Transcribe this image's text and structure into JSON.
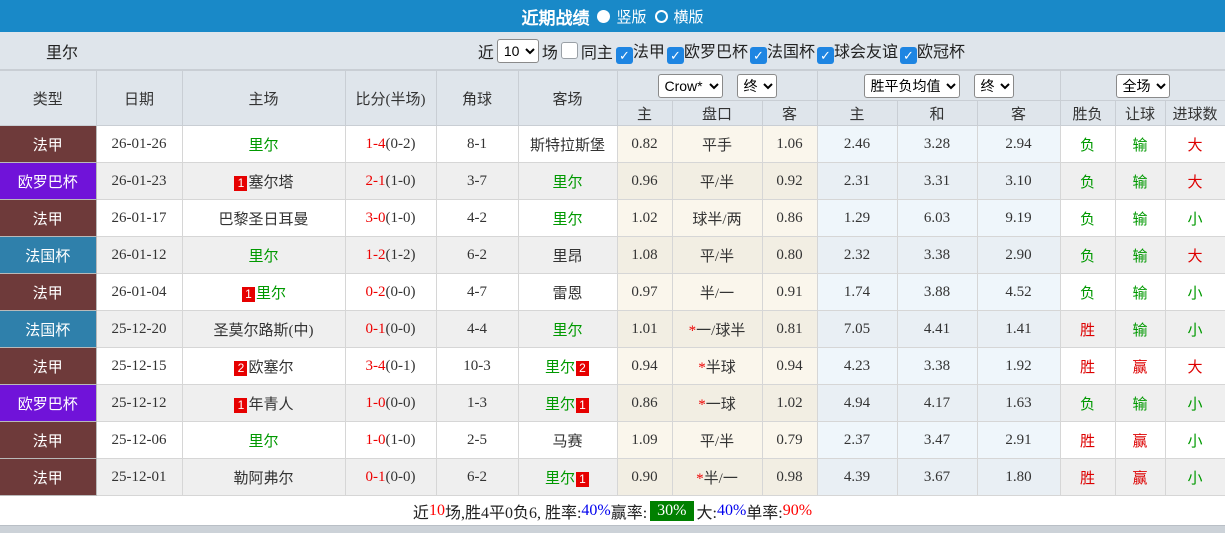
{
  "topbar": {
    "title": "近期战绩",
    "radio_vertical": "竖版",
    "radio_horizontal": "横版"
  },
  "filterbar": {
    "team": "里尔",
    "near_label": "近",
    "near_value": "10",
    "games_label": "场",
    "same_home_label": "同主",
    "leagues": [
      "法甲",
      "欧罗巴杯",
      "法国杯",
      "球会友谊",
      "欧冠杯"
    ]
  },
  "table": {
    "headers": {
      "type": "类型",
      "date": "日期",
      "home": "主场",
      "score": "比分(半场)",
      "corner": "角球",
      "away": "客场",
      "crow_select": "Crow*",
      "final1": "终",
      "avg_select": "胜平负均值",
      "final2": "终",
      "full_select": "全场",
      "sub": [
        "主",
        "盘口",
        "客",
        "主",
        "和",
        "客",
        "胜负",
        "让球",
        "进球数"
      ]
    },
    "league_colors": {
      "法甲": "#6e3a3a",
      "欧罗巴杯": "#7013d9",
      "法国杯": "#2f80ab"
    },
    "rows": [
      {
        "league": "法甲",
        "date": "26-01-26",
        "home": {
          "name": "里尔",
          "green": true,
          "badge": null
        },
        "score": "1-4",
        "half": "(0-2)",
        "corner": "8-1",
        "away": {
          "name": "斯特拉斯堡",
          "green": false,
          "badge": null
        },
        "crow": {
          "home": "0.82",
          "star": false,
          "handicap": "平手",
          "away": "1.06"
        },
        "avg": {
          "home": "2.46",
          "draw": "3.28",
          "away": "2.94"
        },
        "result": {
          "wdl": "负",
          "wdl_c": "green",
          "let": "输",
          "let_c": "green",
          "goals": "大",
          "goals_c": "red"
        }
      },
      {
        "league": "欧罗巴杯",
        "date": "26-01-23",
        "home": {
          "name": "塞尔塔",
          "green": false,
          "badge": "1"
        },
        "score": "2-1",
        "half": "(1-0)",
        "corner": "3-7",
        "away": {
          "name": "里尔",
          "green": true,
          "badge": null
        },
        "crow": {
          "home": "0.96",
          "star": false,
          "handicap": "平/半",
          "away": "0.92"
        },
        "avg": {
          "home": "2.31",
          "draw": "3.31",
          "away": "3.10"
        },
        "result": {
          "wdl": "负",
          "wdl_c": "green",
          "let": "输",
          "let_c": "green",
          "goals": "大",
          "goals_c": "red"
        }
      },
      {
        "league": "法甲",
        "date": "26-01-17",
        "home": {
          "name": "巴黎圣日耳曼",
          "green": false,
          "badge": null
        },
        "score": "3-0",
        "half": "(1-0)",
        "corner": "4-2",
        "away": {
          "name": "里尔",
          "green": true,
          "badge": null
        },
        "crow": {
          "home": "1.02",
          "star": false,
          "handicap": "球半/两",
          "away": "0.86"
        },
        "avg": {
          "home": "1.29",
          "draw": "6.03",
          "away": "9.19"
        },
        "result": {
          "wdl": "负",
          "wdl_c": "green",
          "let": "输",
          "let_c": "green",
          "goals": "小",
          "goals_c": "green"
        }
      },
      {
        "league": "法国杯",
        "date": "26-01-12",
        "home": {
          "name": "里尔",
          "green": true,
          "badge": null
        },
        "score": "1-2",
        "half": "(1-2)",
        "corner": "6-2",
        "away": {
          "name": "里昂",
          "green": false,
          "badge": null
        },
        "crow": {
          "home": "1.08",
          "star": false,
          "handicap": "平/半",
          "away": "0.80"
        },
        "avg": {
          "home": "2.32",
          "draw": "3.38",
          "away": "2.90"
        },
        "result": {
          "wdl": "负",
          "wdl_c": "green",
          "let": "输",
          "let_c": "green",
          "goals": "大",
          "goals_c": "red"
        }
      },
      {
        "league": "法甲",
        "date": "26-01-04",
        "home": {
          "name": "里尔",
          "green": true,
          "badge": "1"
        },
        "score": "0-2",
        "half": "(0-0)",
        "corner": "4-7",
        "away": {
          "name": "雷恩",
          "green": false,
          "badge": null
        },
        "crow": {
          "home": "0.97",
          "star": false,
          "handicap": "半/一",
          "away": "0.91"
        },
        "avg": {
          "home": "1.74",
          "draw": "3.88",
          "away": "4.52"
        },
        "result": {
          "wdl": "负",
          "wdl_c": "green",
          "let": "输",
          "let_c": "green",
          "goals": "小",
          "goals_c": "green"
        }
      },
      {
        "league": "法国杯",
        "date": "25-12-20",
        "home": {
          "name": "圣莫尔路斯(中)",
          "green": false,
          "badge": null
        },
        "score": "0-1",
        "half": "(0-0)",
        "corner": "4-4",
        "away": {
          "name": "里尔",
          "green": true,
          "badge": null
        },
        "crow": {
          "home": "1.01",
          "star": true,
          "handicap": "一/球半",
          "away": "0.81"
        },
        "avg": {
          "home": "7.05",
          "draw": "4.41",
          "away": "1.41"
        },
        "result": {
          "wdl": "胜",
          "wdl_c": "red",
          "let": "输",
          "let_c": "green",
          "goals": "小",
          "goals_c": "green"
        }
      },
      {
        "league": "法甲",
        "date": "25-12-15",
        "home": {
          "name": "欧塞尔",
          "green": false,
          "badge": "2"
        },
        "score": "3-4",
        "half": "(0-1)",
        "corner": "10-3",
        "away": {
          "name": "里尔",
          "green": true,
          "badge": "2"
        },
        "crow": {
          "home": "0.94",
          "star": true,
          "handicap": "半球",
          "away": "0.94"
        },
        "avg": {
          "home": "4.23",
          "draw": "3.38",
          "away": "1.92"
        },
        "result": {
          "wdl": "胜",
          "wdl_c": "red",
          "let": "赢",
          "let_c": "red",
          "goals": "大",
          "goals_c": "red"
        }
      },
      {
        "league": "欧罗巴杯",
        "date": "25-12-12",
        "home": {
          "name": "年青人",
          "green": false,
          "badge": "1"
        },
        "score": "1-0",
        "half": "(0-0)",
        "corner": "1-3",
        "away": {
          "name": "里尔",
          "green": true,
          "badge": "1"
        },
        "crow": {
          "home": "0.86",
          "star": true,
          "handicap": "一球",
          "away": "1.02"
        },
        "avg": {
          "home": "4.94",
          "draw": "4.17",
          "away": "1.63"
        },
        "result": {
          "wdl": "负",
          "wdl_c": "green",
          "let": "输",
          "let_c": "green",
          "goals": "小",
          "goals_c": "green"
        }
      },
      {
        "league": "法甲",
        "date": "25-12-06",
        "home": {
          "name": "里尔",
          "green": true,
          "badge": null
        },
        "score": "1-0",
        "half": "(1-0)",
        "corner": "2-5",
        "away": {
          "name": "马赛",
          "green": false,
          "badge": null
        },
        "crow": {
          "home": "1.09",
          "star": false,
          "handicap": "平/半",
          "away": "0.79"
        },
        "avg": {
          "home": "2.37",
          "draw": "3.47",
          "away": "2.91"
        },
        "result": {
          "wdl": "胜",
          "wdl_c": "red",
          "let": "赢",
          "let_c": "red",
          "goals": "小",
          "goals_c": "green"
        }
      },
      {
        "league": "法甲",
        "date": "25-12-01",
        "home": {
          "name": "勒阿弗尔",
          "green": false,
          "badge": null
        },
        "score": "0-1",
        "half": "(0-0)",
        "corner": "6-2",
        "away": {
          "name": "里尔",
          "green": true,
          "badge": "1"
        },
        "crow": {
          "home": "0.90",
          "star": true,
          "handicap": "半/一",
          "away": "0.98"
        },
        "avg": {
          "home": "4.39",
          "draw": "3.67",
          "away": "1.80"
        },
        "result": {
          "wdl": "胜",
          "wdl_c": "red",
          "let": "赢",
          "let_c": "red",
          "goals": "小",
          "goals_c": "green"
        }
      }
    ]
  },
  "footer": {
    "segments": [
      {
        "text": "近",
        "style": "plain"
      },
      {
        "text": "10",
        "style": "red"
      },
      {
        "text": "场,胜4平0负6, 胜率:",
        "style": "plain"
      },
      {
        "text": "40%",
        "style": "blue"
      },
      {
        "text": " 赢率:",
        "style": "plain"
      },
      {
        "text": "30%",
        "style": "green-badge"
      },
      {
        "text": " 大:",
        "style": "plain"
      },
      {
        "text": "40%",
        "style": "blue"
      },
      {
        "text": " 单率:",
        "style": "plain"
      },
      {
        "text": "90%",
        "style": "red"
      }
    ]
  }
}
